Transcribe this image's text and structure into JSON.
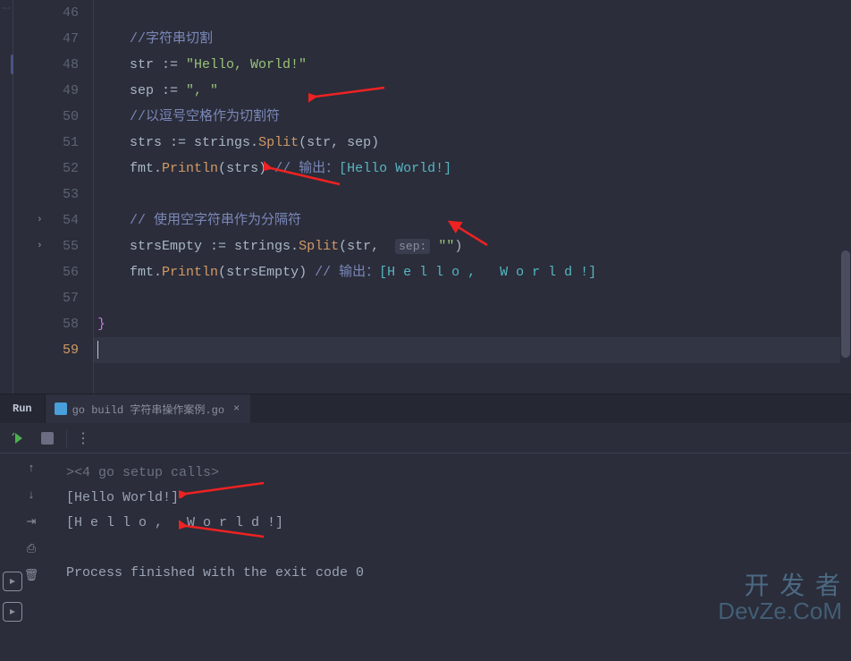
{
  "editor": {
    "lines": {
      "start": 46,
      "end": 59,
      "current": 59
    },
    "code": {
      "l47_comment": "//字符串切割",
      "l48_ident": "str ",
      "l48_op": ":= ",
      "l48_str": "\"Hello, World!\"",
      "l49_ident": "sep ",
      "l49_op": ":= ",
      "l49_str": "\", \"",
      "l50_comment": "//以逗号空格作为切割符",
      "l51_ident": "strs ",
      "l51_op": ":= ",
      "l51_pkg": "strings",
      "l51_dot": ".",
      "l51_fn": "Split",
      "l51_args": "(str, sep)",
      "l52_pkg": "fmt",
      "l52_dot": ".",
      "l52_fn": "Println",
      "l52_args_open": "(",
      "l52_arg": "strs",
      "l52_args_close": ") ",
      "l52_comment": "// 输出：",
      "l52_out": "[Hello World!]",
      "l54_comment": "// 使用空字符串作为分隔符",
      "l55_ident": "strsEmpty ",
      "l55_op": ":= ",
      "l55_pkg": "strings",
      "l55_dot": ".",
      "l55_fn": "Split",
      "l55_open": "(",
      "l55_a1": "str, ",
      "l55_hint": "sep:",
      "l55_sp": " ",
      "l55_str": "\"\"",
      "l55_close": ")",
      "l56_pkg": "fmt",
      "l56_dot": ".",
      "l56_fn": "Println",
      "l56_open": "(",
      "l56_arg": "strsEmpty",
      "l56_close": ") ",
      "l56_comment": "// 输出：",
      "l56_out": "[H e l l o ,   W o r l d !]",
      "l58_brace": "}"
    }
  },
  "run_panel": {
    "run_label": "Run",
    "tab_label": "go build 字符串操作案例.go",
    "output": {
      "l1_chev": ">",
      "l1": "<4 go setup calls>",
      "l2": "[Hello World!]",
      "l3": "[H e l l o ,   W o r l d !]",
      "l4": "Process finished with the exit code 0"
    }
  },
  "watermark": {
    "line1": "开 发 者",
    "line2": "DevZe.CoM"
  }
}
